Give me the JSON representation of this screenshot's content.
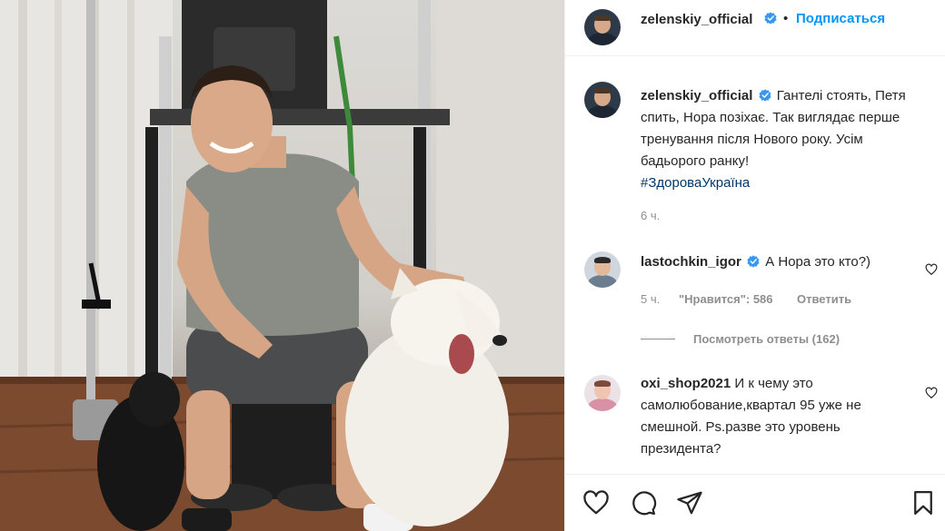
{
  "post": {
    "author": "zelenskiy_official",
    "follow_label": "Подписаться",
    "separator": "•",
    "caption": "Гантелі стоять, Петя спить, Нора позіхає. Так виглядає перше тренування після Нового року. Усім бадьорого ранку!",
    "hashtag": "#ЗдороваУкраїна",
    "time": "6 ч."
  },
  "comments": [
    {
      "user": "lastochkin_igor",
      "verified": true,
      "text": "А Нора это кто?)",
      "time": "5 ч.",
      "likes": "\"Нравится\": 586",
      "reply_label": "Ответить",
      "view_replies": "Посмотреть ответы (162)"
    },
    {
      "user": "oxi_shop2021",
      "verified": false,
      "text": "И к чему это самолюбование,квартал 95 уже не смешной. Ps.разве это уровень президента?"
    }
  ],
  "actions": {
    "icons": [
      "heart-icon",
      "comment-icon",
      "share-icon",
      "bookmark-icon"
    ]
  },
  "colors": {
    "accent": "#0095f6",
    "verified": "#3897f0",
    "hashtag": "#00376b",
    "muted": "#8e8e8e",
    "text": "#262626"
  }
}
